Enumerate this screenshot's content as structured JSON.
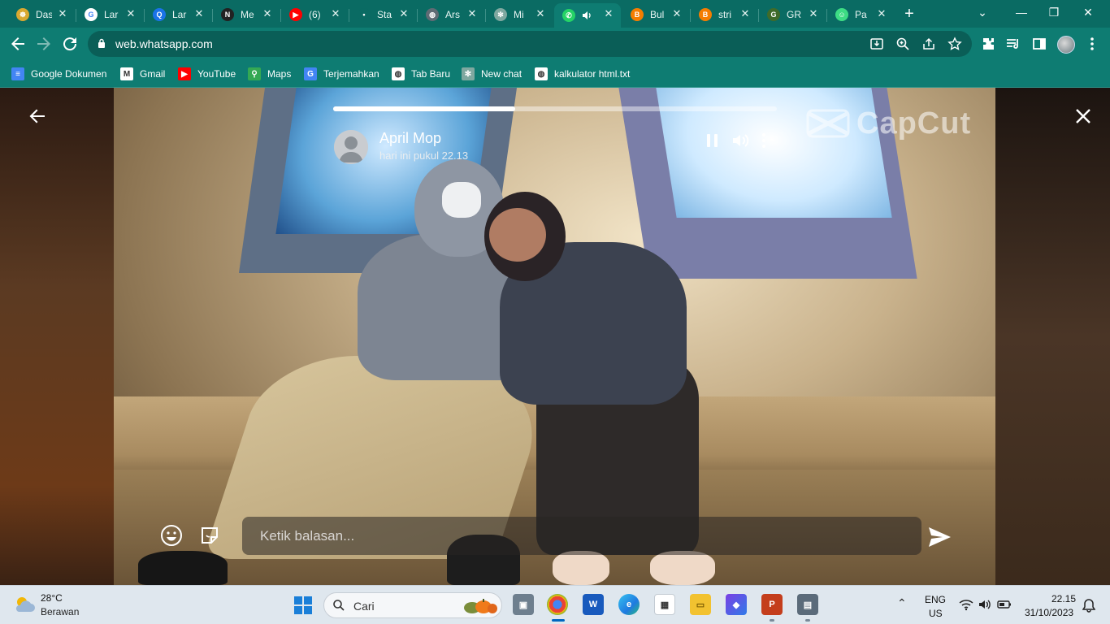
{
  "browser": {
    "tabs": [
      {
        "title": "Das",
        "icon": "buddha-favicon",
        "color": "#d9a830",
        "glyph": "☸"
      },
      {
        "title": "Lar",
        "icon": "google-favicon",
        "color": "#ffffff",
        "glyph": "G"
      },
      {
        "title": "Lar",
        "icon": "search-favicon",
        "color": "#1a73e8",
        "glyph": "Q"
      },
      {
        "title": "Me",
        "icon": "n-favicon",
        "color": "#222222",
        "glyph": "N"
      },
      {
        "title": "(6)",
        "icon": "youtube-favicon",
        "color": "#ff0000",
        "glyph": "▶"
      },
      {
        "title": "Sta",
        "icon": "dot-favicon",
        "color": "#0a6b63",
        "glyph": "•"
      },
      {
        "title": "Ars",
        "icon": "globe-favicon",
        "color": "#5f6b74",
        "glyph": "◍"
      },
      {
        "title": "Mi",
        "icon": "chatgpt-favicon",
        "color": "#7fa8a0",
        "glyph": "✻"
      },
      {
        "title": "",
        "icon": "whatsapp-favicon",
        "color": "#25d366",
        "glyph": "✆",
        "active": true
      },
      {
        "title": "Bul",
        "icon": "blogger-favicon",
        "color": "#f57d00",
        "glyph": "B"
      },
      {
        "title": "stri",
        "icon": "blogger-favicon",
        "color": "#f57d00",
        "glyph": "B"
      },
      {
        "title": "GR",
        "icon": "gr-favicon",
        "color": "#3f6b2a",
        "glyph": "G"
      },
      {
        "title": "Pa",
        "icon": "android-favicon",
        "color": "#3ddc84",
        "glyph": "☺"
      }
    ],
    "url": "web.whatsapp.com",
    "bookmarks": [
      {
        "label": "Google Dokumen",
        "icon": "docs-icon",
        "color": "#4285f4",
        "glyph": "≡"
      },
      {
        "label": "Gmail",
        "icon": "gmail-icon",
        "color": "#ffffff",
        "glyph": "M"
      },
      {
        "label": "YouTube",
        "icon": "youtube-icon",
        "color": "#ff0000",
        "glyph": "▶"
      },
      {
        "label": "Maps",
        "icon": "maps-icon",
        "color": "#34a853",
        "glyph": "⚲"
      },
      {
        "label": "Terjemahkan",
        "icon": "translate-icon",
        "color": "#4285f4",
        "glyph": "G"
      },
      {
        "label": "Tab Baru",
        "icon": "globe-icon",
        "color": "#ffffff",
        "glyph": "◍"
      },
      {
        "label": "New chat",
        "icon": "chatgpt-icon",
        "color": "#7fa8a0",
        "glyph": "✻"
      },
      {
        "label": "kalkulator html.txt",
        "icon": "globe-icon",
        "color": "#ffffff",
        "glyph": "◍"
      }
    ]
  },
  "status": {
    "watermark": "CapCut",
    "progress_fraction": 0.41,
    "poster_name": "April Mop",
    "posted_time": "hari ini pukul 22.13",
    "reply_placeholder": "Ketik balasan..."
  },
  "taskbar": {
    "weather_temp": "28°C",
    "weather_desc": "Berawan",
    "search_placeholder": "Cari",
    "lang_line1": "ENG",
    "lang_line2": "US",
    "clock_time": "22.15",
    "clock_date": "31/10/2023"
  }
}
